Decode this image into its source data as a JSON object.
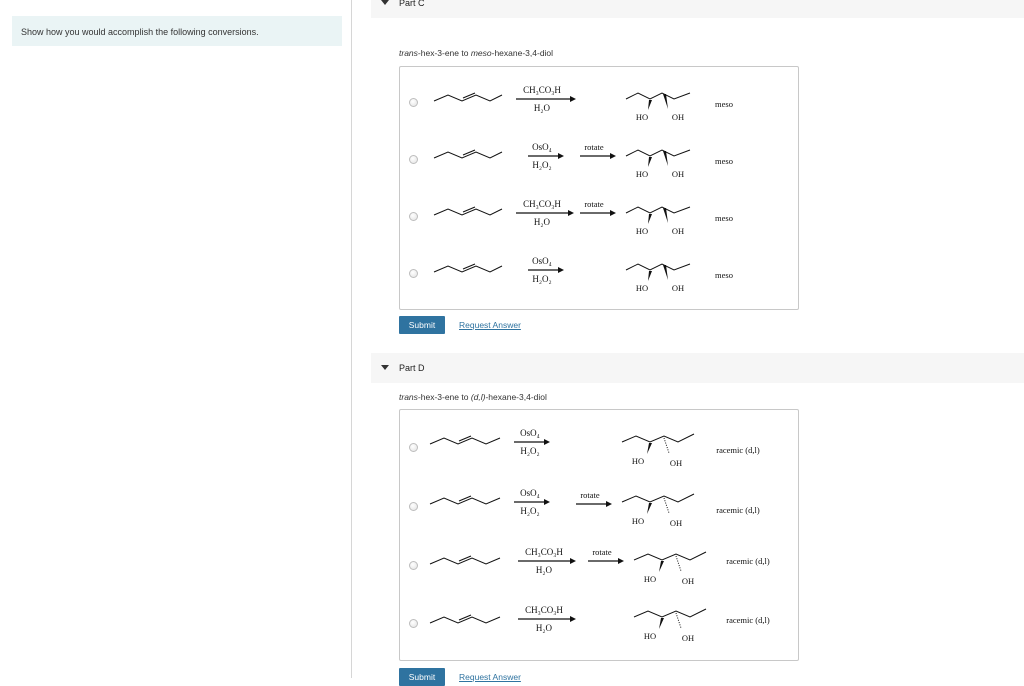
{
  "left": {
    "prompt": "Show how you would accomplish the following conversions."
  },
  "partC": {
    "header": "Part C",
    "question_prefix": "trans",
    "question_mid": "-hex-3-ene to ",
    "question_meso": "meso",
    "question_suffix": "-hexane-3,4-diol",
    "choices": [
      {
        "reagent_top": "CH₃CO₃H",
        "reagent_bottom": "H₂O",
        "rotate": "",
        "oh_left": "HO",
        "oh_right": "OH",
        "result": "meso"
      },
      {
        "reagent_top": "OsO₄",
        "reagent_bottom": "H₂O₂",
        "rotate": "rotate",
        "oh_left": "HO",
        "oh_right": "OH",
        "result": "meso"
      },
      {
        "reagent_top": "CH₃CO₃H",
        "reagent_bottom": "H₂O",
        "rotate": "rotate",
        "oh_left": "HO",
        "oh_right": "OH",
        "result": "meso"
      },
      {
        "reagent_top": "OsO₄",
        "reagent_bottom": "H₂O₂",
        "rotate": "",
        "oh_left": "HO",
        "oh_right": "OH",
        "result": "meso"
      }
    ],
    "submit_label": "Submit",
    "request_label": "Request Answer"
  },
  "partD": {
    "header": "Part D",
    "question_prefix": "trans",
    "question_mid": "-hex-3-ene to ",
    "question_dl": "(d,l)",
    "question_suffix": "-hexane-3,4-diol",
    "choices": [
      {
        "reagent_top": "OsO₄",
        "reagent_bottom": "H₂O₂",
        "rotate": "",
        "oh_left": "HO",
        "oh_right": "OH",
        "result": "racemic (d,l)"
      },
      {
        "reagent_top": "OsO₄",
        "reagent_bottom": "H₂O₂",
        "rotate": "rotate",
        "oh_left": "HO",
        "oh_right": "OH",
        "result": "racemic (d,l)"
      },
      {
        "reagent_top": "CH₃CO₃H",
        "reagent_bottom": "H₂O",
        "rotate": "rotate",
        "oh_left": "HO",
        "oh_right": "OH",
        "result": "racemic (d,l)"
      },
      {
        "reagent_top": "CH₃CO₃H",
        "reagent_bottom": "H₂O",
        "rotate": "",
        "oh_left": "HO",
        "oh_right": "OH",
        "result": "racemic (d,l)"
      }
    ],
    "submit_label": "Submit",
    "request_label": "Request Answer"
  }
}
